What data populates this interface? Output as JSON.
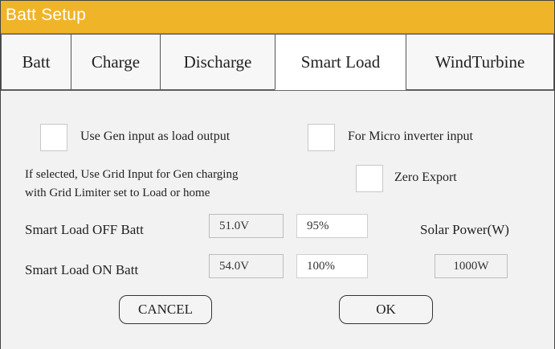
{
  "window": {
    "title": "Batt Setup"
  },
  "tabs": [
    {
      "label": "Batt"
    },
    {
      "label": "Charge"
    },
    {
      "label": "Discharge"
    },
    {
      "label": "Smart Load",
      "active": true
    },
    {
      "label": "WindTurbine"
    }
  ],
  "options": {
    "gen_input_label": "Use Gen input as load output",
    "micro_inverter_label": "For Micro inverter input",
    "note_line1": "If selected, Use Grid Input for Gen charging",
    "note_line2": "with Grid Limiter set to Load or home",
    "zero_export_label": "Zero Export"
  },
  "smart_load": {
    "off_label": "Smart Load OFF Batt",
    "off_voltage": "51.0V",
    "off_percent": "95%",
    "on_label": "Smart Load ON Batt",
    "on_voltage": "54.0V",
    "on_percent": "100%",
    "solar_label": "Solar Power(W)",
    "solar_value": "1000W"
  },
  "buttons": {
    "cancel": "CANCEL",
    "ok": "OK"
  },
  "colors": {
    "titlebar": "#f0b429",
    "title_text": "#ffffff",
    "panel": "#f2f2f2"
  }
}
